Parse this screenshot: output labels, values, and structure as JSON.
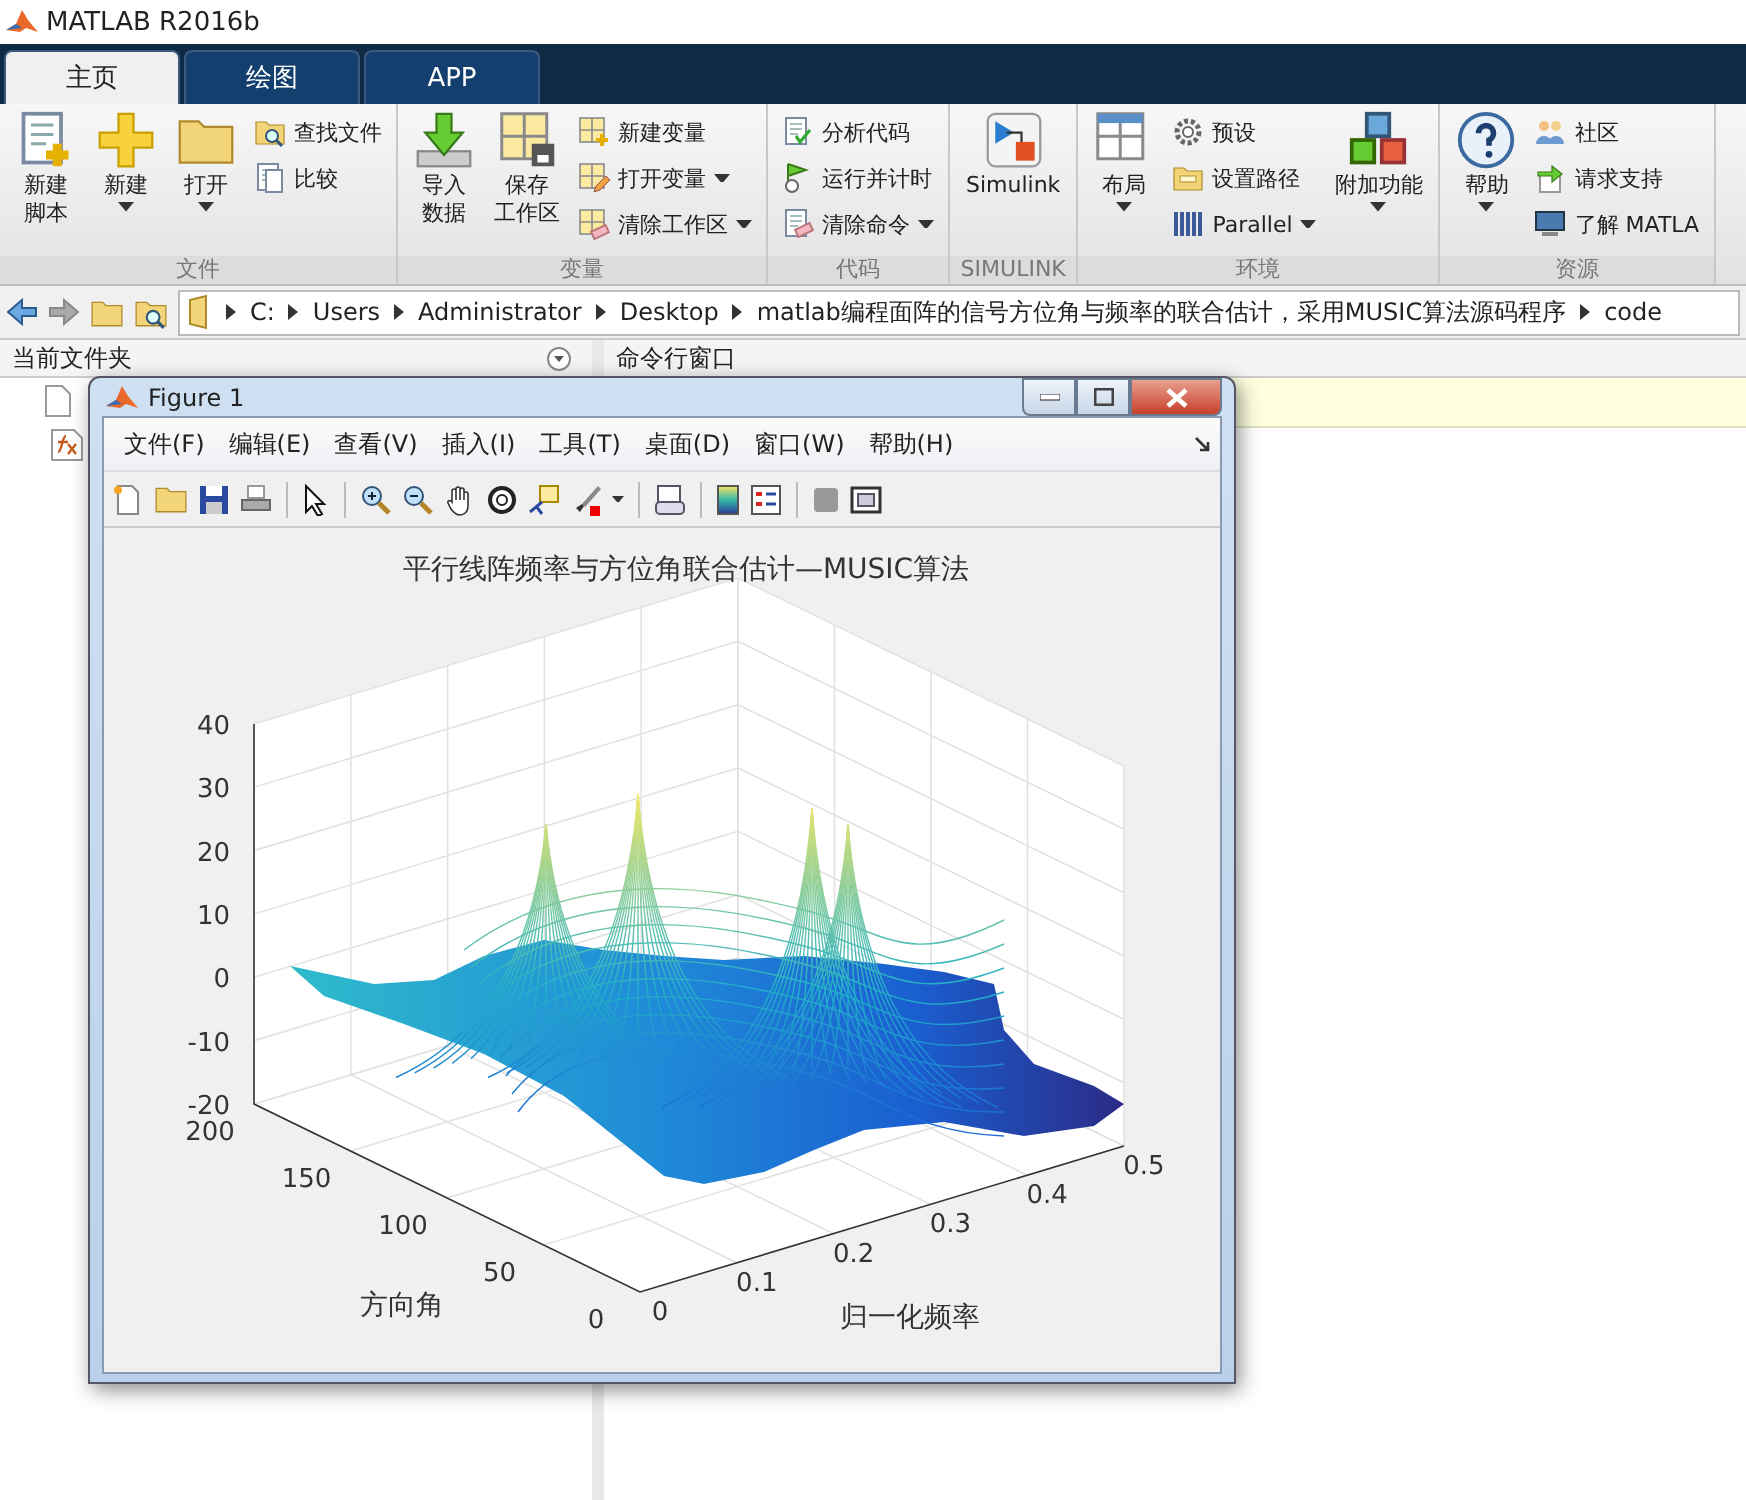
{
  "window": {
    "title": "MATLAB R2016b"
  },
  "tabs": [
    {
      "label": "主页",
      "selected": true
    },
    {
      "label": "绘图",
      "selected": false
    },
    {
      "label": "APP",
      "selected": false
    }
  ],
  "ribbon": {
    "groups": [
      {
        "label": "文件",
        "columns": [
          {
            "kind": "large",
            "lines": [
              "新建",
              "脚本"
            ],
            "dropdown": false
          },
          {
            "kind": "large",
            "lines": [
              "新建"
            ],
            "dropdown": true
          },
          {
            "kind": "large",
            "lines": [
              "打开"
            ],
            "dropdown": true
          },
          {
            "kind": "stack",
            "items": [
              {
                "label": "查找文件",
                "dropdown": false
              },
              {
                "label": "比较",
                "dropdown": false
              }
            ]
          }
        ]
      },
      {
        "label": "变量",
        "columns": [
          {
            "kind": "large",
            "lines": [
              "导入",
              "数据"
            ],
            "dropdown": false
          },
          {
            "kind": "large",
            "lines": [
              "保存",
              "工作区"
            ],
            "dropdown": false
          },
          {
            "kind": "stack",
            "items": [
              {
                "label": "新建变量",
                "dropdown": false
              },
              {
                "label": "打开变量",
                "dropdown": true
              },
              {
                "label": "清除工作区",
                "dropdown": true
              }
            ]
          }
        ]
      },
      {
        "label": "代码",
        "columns": [
          {
            "kind": "stack",
            "items": [
              {
                "label": "分析代码",
                "dropdown": false
              },
              {
                "label": "运行并计时",
                "dropdown": false
              },
              {
                "label": "清除命令",
                "dropdown": true
              }
            ]
          }
        ]
      },
      {
        "label": "SIMULINK",
        "columns": [
          {
            "kind": "large",
            "lines": [
              "Simulink"
            ],
            "dropdown": false
          }
        ]
      },
      {
        "label": "环境",
        "columns": [
          {
            "kind": "large",
            "lines": [
              "布局"
            ],
            "dropdown": true
          },
          {
            "kind": "stack",
            "items": [
              {
                "label": "预设",
                "dropdown": false
              },
              {
                "label": "设置路径",
                "dropdown": false
              },
              {
                "label": "Parallel",
                "dropdown": true
              }
            ]
          },
          {
            "kind": "large",
            "lines": [
              "附加功能"
            ],
            "dropdown": true
          }
        ]
      },
      {
        "label": "资源",
        "columns": [
          {
            "kind": "large",
            "lines": [
              "帮助"
            ],
            "dropdown": true
          },
          {
            "kind": "stack",
            "items": [
              {
                "label": "社区",
                "dropdown": false
              },
              {
                "label": "请求支持",
                "dropdown": false
              },
              {
                "label": "了解 MATLA",
                "dropdown": false
              }
            ]
          }
        ]
      }
    ]
  },
  "address": {
    "path": [
      "C:",
      "Users",
      "Administrator",
      "Desktop",
      "matlab编程面阵的信号方位角与频率的联合估计，采用MUSIC算法源码程序",
      "code"
    ]
  },
  "current_folder": {
    "title": "当前文件夹"
  },
  "command_window": {
    "title": "命令行窗口"
  },
  "figure": {
    "title": "Figure 1",
    "menus": [
      "文件(F)",
      "编辑(E)",
      "查看(V)",
      "插入(I)",
      "工具(T)",
      "桌面(D)",
      "窗口(W)",
      "帮助(H)"
    ],
    "plot": {
      "title": "平行线阵频率与方位角联合估计—MUSIC算法",
      "z_ticks": [
        "40",
        "30",
        "20",
        "10",
        "0",
        "-10",
        "-20"
      ],
      "angle_ticks": [
        "200",
        "150",
        "100",
        "50",
        "0"
      ],
      "freq_ticks": [
        "0",
        "0.1",
        "0.2",
        "0.3",
        "0.4",
        "0.5"
      ],
      "angle_label": "方向角",
      "freq_label": "归一化频率"
    }
  }
}
